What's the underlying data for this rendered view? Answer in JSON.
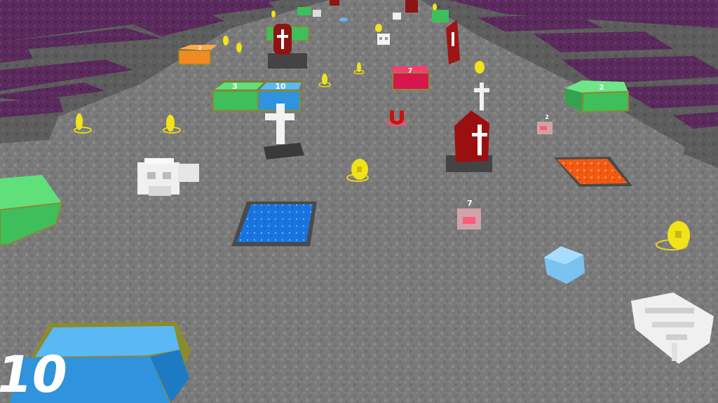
{
  "crates": {
    "green_3": "3",
    "blue_10": "10",
    "red_7": "7",
    "green_right_2": "2",
    "orange_small": "2",
    "blue_foreground": "10"
  },
  "cans": {
    "near_label": "7",
    "far_label": "2"
  },
  "colors": {
    "ground": "#7a7a7a",
    "wall_top": "#5a2a5c",
    "wall_side": "#585858",
    "water": "#1e7fe6",
    "lava": "#f05a14",
    "coin": "#f2e21a",
    "crate_green": "#4fcf6a",
    "crate_blue": "#3ea2e8",
    "crate_red": "#d8164e",
    "tomb_red": "#9a1010"
  },
  "icons": [
    "coin-icon",
    "magnet-icon",
    "skull-icon",
    "cross-icon",
    "tombstone-icon",
    "bone-icon",
    "ice-cube-icon"
  ]
}
